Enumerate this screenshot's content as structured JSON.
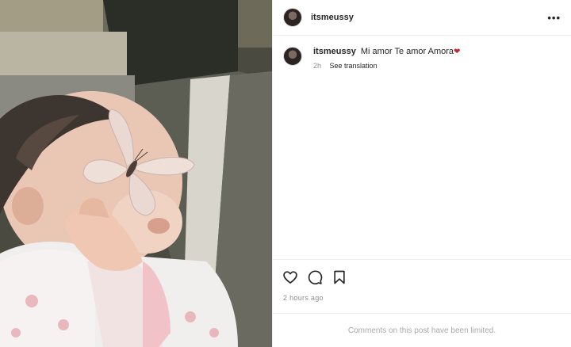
{
  "post": {
    "username": "itsmeussy",
    "photo_alt": "",
    "caption": {
      "username": "itsmeussy",
      "text": "Mi amor Te amor Amora",
      "emoji": "❤",
      "age": "2h",
      "translate_label": "See translation"
    },
    "timestamp": "2 hours ago",
    "comments_notice": "Comments on this post have been limited.",
    "more_label": "•••"
  },
  "icons": {
    "like": "heart-outline-icon",
    "comment": "comment-bubble-icon",
    "save": "bookmark-icon",
    "more": "more-options-icon"
  },
  "colors": {
    "text": "#262626",
    "secondary": "#8e8e8e",
    "divider": "#efefef",
    "emoji_heart": "#c0282a"
  }
}
